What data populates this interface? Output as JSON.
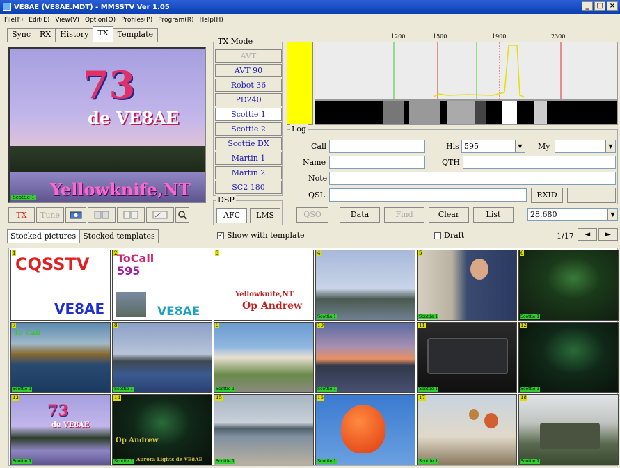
{
  "window": {
    "title": "VE8AE (VE8AE.MDT) - MMSSTV Ver 1.05",
    "buttons": [
      "_",
      "□",
      "×"
    ]
  },
  "menu": [
    "File(F)",
    "Edit(E)",
    "View(V)",
    "Option(O)",
    "Profiles(P)",
    "Program(R)",
    "Help(H)"
  ],
  "tabs": [
    "Sync",
    "RX",
    "History",
    "TX",
    "Template"
  ],
  "preview": {
    "big": "73",
    "de": "de VE8AE",
    "location": "Yellowknife,NT",
    "mode_tag": "Scottie 1"
  },
  "txbar": {
    "tx": "TX",
    "tune": "Tune"
  },
  "tx_mode": {
    "legend": "TX Mode",
    "items": [
      "AVT",
      "AVT 90",
      "Robot 36",
      "PD240",
      "Scottie 1",
      "Scottie 2",
      "Scottie DX",
      "Martin 1",
      "Martin 2",
      "SC2 180"
    ],
    "selected": "Scottie 1"
  },
  "dsp": {
    "legend": "DSP",
    "afc": "AFC",
    "lms": "LMS"
  },
  "spectrum": {
    "ticks": [
      "1200",
      "1500",
      "1900",
      "2300"
    ],
    "colors": {
      "sync": "#ffff00",
      "marker_green": "#33cc33",
      "marker_red": "#e03030"
    }
  },
  "log": {
    "legend": "Log",
    "call_label": "Call",
    "call_value": "",
    "his_label": "His",
    "his_value": "595",
    "my_label": "My",
    "my_value": "",
    "name_label": "Name",
    "name_value": "",
    "qth_label": "QTH",
    "qth_value": "",
    "note_label": "Note",
    "note_value": "",
    "qsl_label": "QSL",
    "qsl_value": "",
    "rxid": "RXID"
  },
  "buttons": {
    "qso": "QSO",
    "data": "Data",
    "find": "Find",
    "clear": "Clear",
    "list": "List",
    "freq": "28.680"
  },
  "options": {
    "show_template": "Show with template",
    "draft": "Draft",
    "page": "1/17"
  },
  "stock_tabs": [
    "Stocked pictures",
    "Stocked templates"
  ],
  "thumbs": [
    {
      "num": "1",
      "tag": "",
      "texts": [
        "CQSSTV",
        "VE8AE"
      ]
    },
    {
      "num": "2",
      "tag": "",
      "texts": [
        "ToCall",
        "595",
        "VE8AE"
      ]
    },
    {
      "num": "3",
      "tag": "",
      "texts": [
        "Yellowknife,NT",
        "Op Andrew"
      ]
    },
    {
      "num": "4",
      "tag": "Scottie 1",
      "texts": []
    },
    {
      "num": "5",
      "tag": "Scottie 1",
      "texts": []
    },
    {
      "num": "6",
      "tag": "Scottie 1",
      "texts": []
    },
    {
      "num": "7",
      "tag": "Scottie 1",
      "texts": [
        "To Call"
      ]
    },
    {
      "num": "8",
      "tag": "Scottie 1",
      "texts": []
    },
    {
      "num": "9",
      "tag": "Scottie 1",
      "texts": []
    },
    {
      "num": "10",
      "tag": "Scottie 1",
      "texts": []
    },
    {
      "num": "11",
      "tag": "Scottie 1",
      "texts": []
    },
    {
      "num": "12",
      "tag": "Scottie 1",
      "texts": []
    },
    {
      "num": "13",
      "tag": "Scottie 1",
      "texts": [
        "73",
        "de VE8AE"
      ]
    },
    {
      "num": "14",
      "tag": "Scottie 1",
      "texts": [
        "Op Andrew",
        "Aurora Lights de VE8AE"
      ]
    },
    {
      "num": "15",
      "tag": "Scottie 1",
      "texts": []
    },
    {
      "num": "16",
      "tag": "Scottie 1",
      "texts": []
    },
    {
      "num": "17",
      "tag": "Scottie 1",
      "texts": []
    },
    {
      "num": "18",
      "tag": "Scottie 1",
      "texts": []
    }
  ]
}
